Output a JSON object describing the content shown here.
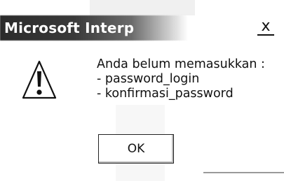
{
  "window": {
    "title": "Microsoft Interp",
    "close_glyph": "x"
  },
  "icon": "warning-icon",
  "message": {
    "line1": "Anda belum memasukkan :",
    "line2": "- password_login",
    "line3": "- konfirmasi_password"
  },
  "buttons": {
    "ok_label": "OK"
  }
}
